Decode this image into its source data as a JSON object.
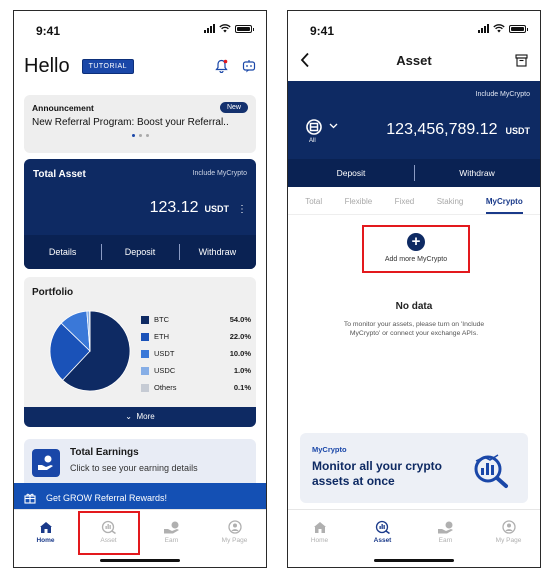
{
  "status": {
    "time": "9:41"
  },
  "left": {
    "greeting": "Hello",
    "tutorial_label": "TUTORIAL",
    "announcement": {
      "title": "Announcement",
      "badge": "New",
      "text": "New Referral Program: Boost your Referral.."
    },
    "total_asset": {
      "title": "Total Asset",
      "include": "Include MyCrypto",
      "value": "123.12",
      "unit": "USDT",
      "more": "⋮",
      "actions": [
        "Details",
        "Deposit",
        "Withdraw"
      ]
    },
    "portfolio": {
      "title": "Portfolio",
      "more_label": "More",
      "chevron": "⌄"
    },
    "earnings": {
      "title": "Total Earnings",
      "subtitle": "Click to see your earning details"
    },
    "banner": "Get GROW Referral Rewards!",
    "tabs": [
      {
        "label": "Home",
        "icon": "home-icon",
        "active": true
      },
      {
        "label": "Asset",
        "icon": "asset-icon",
        "active": false
      },
      {
        "label": "Earn",
        "icon": "earn-icon",
        "active": false
      },
      {
        "label": "My Page",
        "icon": "user-icon",
        "active": false
      }
    ]
  },
  "right": {
    "title": "Asset",
    "include": "Include MyCrypto",
    "all_label": "All",
    "value": "123,456,789.12",
    "unit": "USDT",
    "actions": [
      "Deposit",
      "Withdraw"
    ],
    "tabs": [
      "Total",
      "Flexible",
      "Fixed",
      "Staking",
      "MyCrypto"
    ],
    "active_tab": "MyCrypto",
    "add_more": "Add more MyCrypto",
    "no_data_title": "No data",
    "no_data_desc_1": "To monitor your assets, please turn on 'Include",
    "no_data_desc_2": "MyCrypto' or connect your exchange APIs.",
    "promo": {
      "tag": "MyCrypto",
      "headline_1": "Monitor all your crypto",
      "headline_2": "assets at once"
    },
    "tabbar": [
      {
        "label": "Home",
        "icon": "home-icon",
        "active": false
      },
      {
        "label": "Asset",
        "icon": "asset-icon",
        "active": true
      },
      {
        "label": "Earn",
        "icon": "earn-icon",
        "active": false
      },
      {
        "label": "My Page",
        "icon": "user-icon",
        "active": false
      }
    ]
  },
  "chart_data": {
    "type": "pie",
    "title": "Portfolio",
    "slices": [
      {
        "name": "BTC",
        "display": "54.0%",
        "value": 54.0,
        "color": "#0e2a63"
      },
      {
        "name": "ETH",
        "display": "22.0%",
        "value": 22.0,
        "color": "#1a52b8"
      },
      {
        "name": "USDT",
        "display": "10.0%",
        "value": 10.0,
        "color": "#3a78d8"
      },
      {
        "name": "USDC",
        "display": "1.0%",
        "value": 1.0,
        "color": "#86aee6"
      },
      {
        "name": "Others",
        "display": "0.1%",
        "value": 0.1,
        "color": "#c6cbd4"
      }
    ]
  },
  "colors": {
    "navy": "#0e2a63",
    "accent": "#1a47a8",
    "highlight": "#e3191d"
  }
}
